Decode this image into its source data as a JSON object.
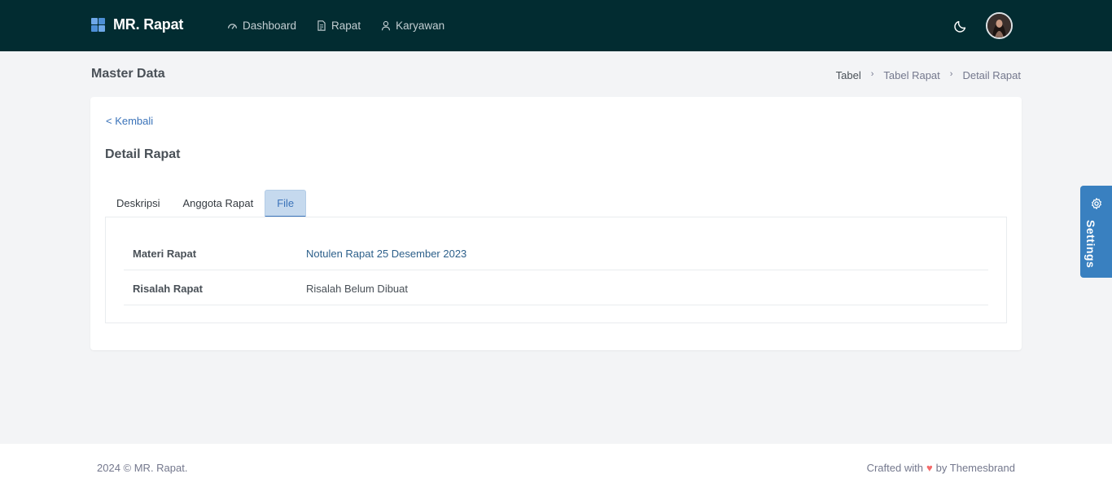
{
  "header": {
    "brand": "MR. Rapat",
    "nav": [
      {
        "label": "Dashboard",
        "icon": "dashboard-icon"
      },
      {
        "label": "Rapat",
        "icon": "document-icon"
      },
      {
        "label": "Karyawan",
        "icon": "user-icon"
      }
    ],
    "theme_icon": "moon-icon",
    "avatar": "avatar"
  },
  "page": {
    "title": "Master Data",
    "breadcrumb": [
      "Tabel",
      "Tabel Rapat",
      "Detail Rapat"
    ]
  },
  "card": {
    "back_label": "< Kembali",
    "title": "Detail Rapat",
    "tabs": [
      {
        "label": "Deskripsi",
        "active": false
      },
      {
        "label": "Anggota Rapat",
        "active": false
      },
      {
        "label": "File",
        "active": true
      }
    ],
    "rows": [
      {
        "label": "Materi Rapat",
        "value": "Notulen Rapat 25 Desember 2023"
      },
      {
        "label": "Risalah Rapat",
        "value": "Risalah Belum Dibuat"
      }
    ]
  },
  "settings": {
    "label": "Settings",
    "icon": "gear-icon"
  },
  "footer": {
    "left": "2024 © MR. Rapat.",
    "right_prefix": "Crafted with",
    "right_suffix": "by Themesbrand"
  },
  "colors": {
    "topbar": "#022c31",
    "accent": "#3b73b9",
    "settings": "#3980c0",
    "heart": "#f46a6a"
  }
}
